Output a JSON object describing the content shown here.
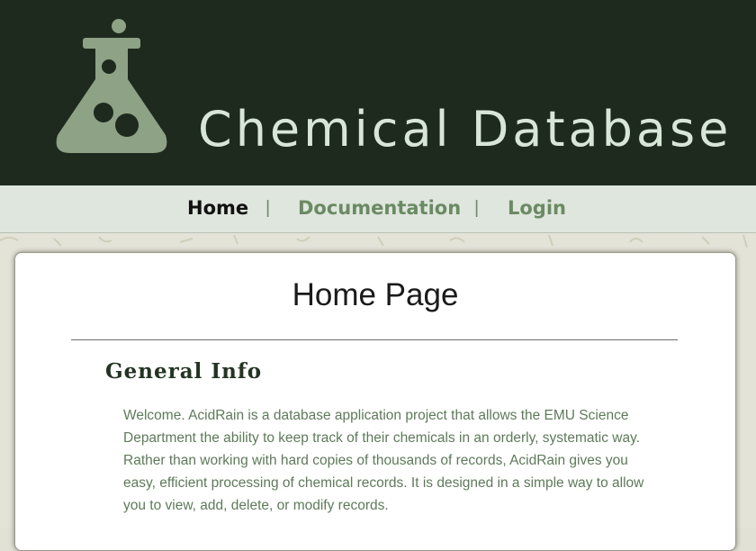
{
  "header": {
    "site_title": "Chemical Database",
    "logo_icon": "flask-icon",
    "colors": {
      "background": "#1e2a1e",
      "title": "#d8e6d8",
      "logo": "#8ea285"
    }
  },
  "nav": {
    "items": [
      {
        "label": "Home",
        "active": true
      },
      {
        "label": "Documentation",
        "active": false
      },
      {
        "label": "Login",
        "active": false
      }
    ],
    "separator": "|",
    "colors": {
      "active": "#111111",
      "link": "#6b8a64",
      "bar": "#dfe6dd"
    }
  },
  "main": {
    "page_title": "Home Page",
    "section": {
      "heading": "General Info",
      "body": "Welcome. AcidRain is a database application project that allows the EMU Science Department the ability to keep track of their chemicals in an orderly, systematic way. Rather than working with hard copies of thousands of records, AcidRain gives you easy, efficient processing of chemical records. It is designed in a simple way to allow you to view, add, delete, or modify records."
    }
  }
}
